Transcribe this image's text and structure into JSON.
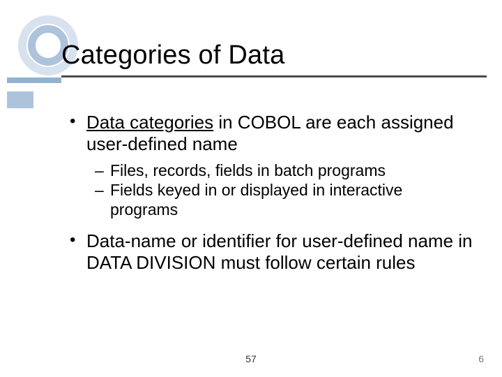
{
  "title": "Categories of Data",
  "bullets": {
    "b1": {
      "underlined": "Data categories",
      "rest": " in COBOL are each assigned user-defined name"
    },
    "sub1": "Files, records, fields in batch programs",
    "sub2": "Fields keyed in or displayed in interactive programs",
    "b2": "Data-name or identifier for user-defined name in DATA DIVISION must follow certain rules"
  },
  "footer_center": "57",
  "page_number": "6"
}
